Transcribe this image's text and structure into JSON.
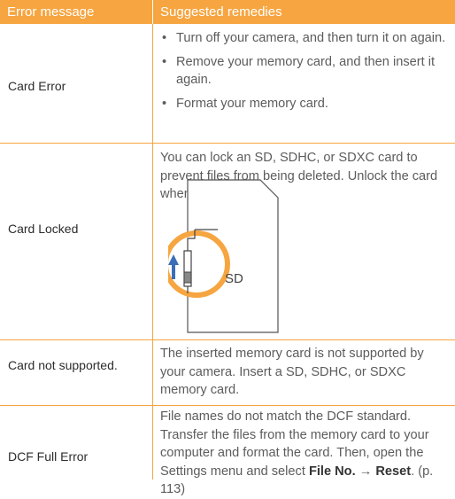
{
  "header": {
    "col1": "Error message",
    "col2": "Suggested remedies"
  },
  "rows": [
    {
      "error": "Card Error",
      "bullets": [
        "Turn off your camera, and then turn it on again.",
        "Remove your memory card, and then insert it again.",
        "Format your memory card."
      ]
    },
    {
      "error": "Card Locked",
      "text": "You can lock an SD, SDHC, or SDXC card to prevent files from being deleted. Unlock the card when shooting.",
      "illustration_label": "SD"
    },
    {
      "error": "Card not supported.",
      "text": "The inserted memory card is not supported by your camera. Insert a SD, SDHC, or SDXC memory card."
    },
    {
      "error": "DCF Full Error",
      "text_before": "File names do not match the DCF standard. Transfer the files from the memory card to your computer and format the card. Then, open the Settings menu and select ",
      "bold_1": "File No.",
      "arrow": " → ",
      "bold_2": "Reset",
      "text_after": ". (p. 113)"
    }
  ],
  "colors": {
    "accent": "#f6a540",
    "header_text": "#ffffff",
    "body_text": "#5c5c5c",
    "label_text": "#2c2c2c"
  }
}
